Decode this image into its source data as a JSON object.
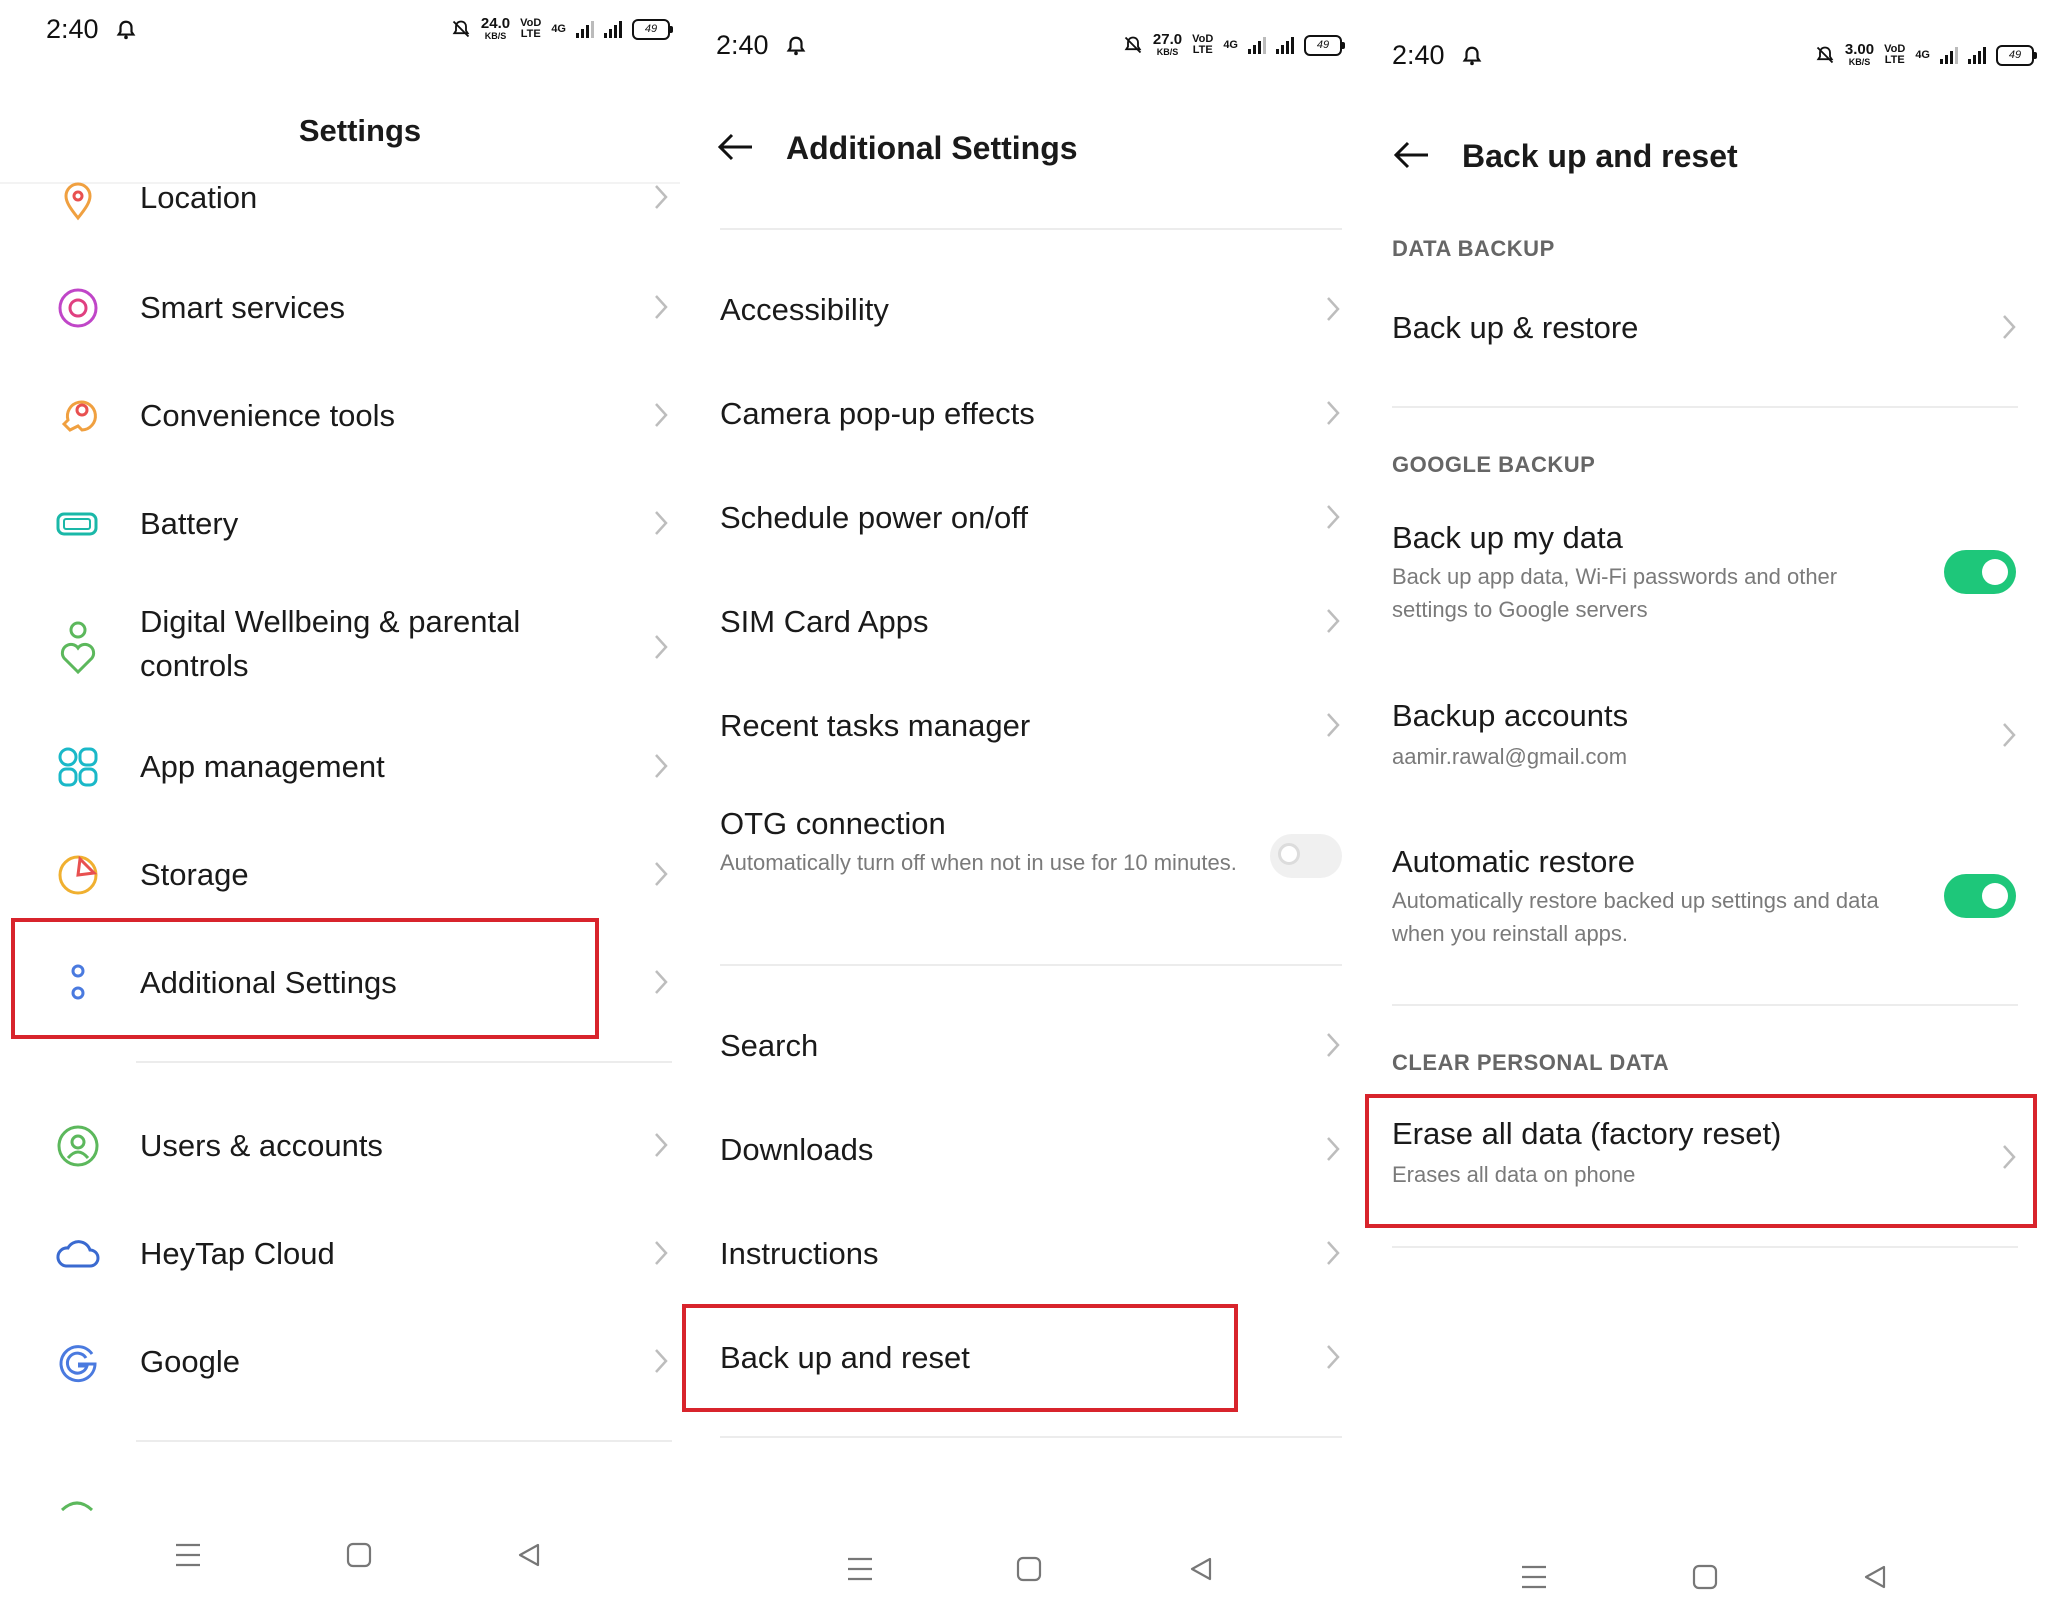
{
  "panel1": {
    "status": {
      "time": "2:40",
      "speed_value": "24.0",
      "speed_unit": "KB/S",
      "volte": "VoD\nLTE",
      "network": "4G",
      "battery": "49"
    },
    "title": "Settings",
    "items": [
      {
        "label": "Location",
        "icon": "location-icon"
      },
      {
        "label": "Smart services",
        "icon": "smart-services-icon"
      },
      {
        "label": "Convenience tools",
        "icon": "convenience-tools-icon"
      },
      {
        "label": "Battery",
        "icon": "battery-icon"
      },
      {
        "label": "Digital Wellbeing & parental controls",
        "icon": "digital-wellbeing-icon"
      },
      {
        "label": "App management",
        "icon": "app-management-icon"
      },
      {
        "label": "Storage",
        "icon": "storage-icon"
      },
      {
        "label": "Additional Settings",
        "icon": "additional-settings-icon"
      },
      {
        "label": "Users & accounts",
        "icon": "users-accounts-icon"
      },
      {
        "label": "HeyTap Cloud",
        "icon": "heytap-cloud-icon"
      },
      {
        "label": "Google",
        "icon": "google-icon"
      }
    ],
    "highlighted": "Additional Settings"
  },
  "panel2": {
    "status": {
      "time": "2:40",
      "speed_value": "27.0",
      "speed_unit": "KB/S",
      "volte": "VoD\nLTE",
      "network": "4G",
      "battery": "49"
    },
    "title": "Additional Settings",
    "items": [
      {
        "label": "Accessibility"
      },
      {
        "label": "Camera pop-up effects"
      },
      {
        "label": "Schedule power on/off"
      },
      {
        "label": "SIM Card Apps"
      },
      {
        "label": "Recent tasks manager"
      },
      {
        "label": "OTG connection",
        "subtitle": "Automatically turn off when not in use for 10 minutes.",
        "toggle": false
      },
      {
        "label": "Search"
      },
      {
        "label": "Downloads"
      },
      {
        "label": "Instructions"
      },
      {
        "label": "Back up and reset"
      }
    ],
    "highlighted": "Back up and reset"
  },
  "panel3": {
    "status": {
      "time": "2:40",
      "speed_value": "3.00",
      "speed_unit": "KB/S",
      "volte": "VoD\nLTE",
      "network": "4G",
      "battery": "49"
    },
    "title": "Back up and reset",
    "sections": [
      {
        "header": "DATA BACKUP",
        "items": [
          {
            "label": "Back up & restore"
          }
        ]
      },
      {
        "header": "GOOGLE BACKUP",
        "items": [
          {
            "label": "Back up my data",
            "subtitle": "Back up app data, Wi-Fi passwords and other settings to Google servers",
            "toggle": true
          },
          {
            "label": "Backup accounts",
            "subtitle": "aamir.rawal@gmail.com"
          },
          {
            "label": "Automatic restore",
            "subtitle": "Automatically restore backed up settings and data when you reinstall apps.",
            "toggle": true
          }
        ]
      },
      {
        "header": "CLEAR PERSONAL DATA",
        "items": [
          {
            "label": "Erase all data (factory reset)",
            "subtitle": "Erases all data on phone"
          }
        ]
      }
    ],
    "highlighted": "Erase all data (factory reset)"
  },
  "colors": {
    "highlight": "#d8242c",
    "toggle_on": "#1ec77a",
    "section_header": "#666666",
    "subtitle": "#7a7a7a"
  },
  "navbar": {
    "icons": [
      "menu-icon",
      "home-icon",
      "back-icon"
    ]
  }
}
